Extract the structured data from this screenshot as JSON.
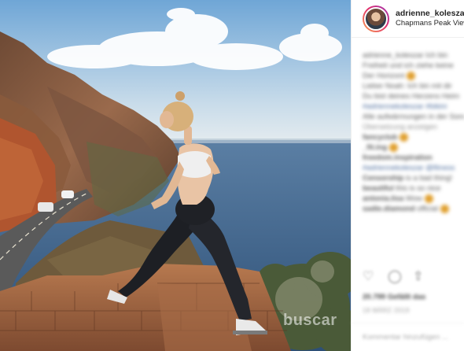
{
  "post": {
    "username": "adrienne_koleszar",
    "location": "Chapmans Peak View"
  },
  "caption": {
    "lines": [
      "adrienne_koleszar Ich bin",
      "Freiheit und ich ziehe keine",
      "Der Horizont ",
      "Lieber Noah: Ich bin mit dir",
      "Du bist deines Herzens Heim",
      "#adriennekoleszar #bikini",
      "Alle aufwärmungen in der Sonne"
    ],
    "translation": "Übersetzung anzeigen"
  },
  "comments": [
    {
      "user": "fancyclub",
      "text": ""
    },
    {
      "user": "_fit.ing",
      "text": ""
    },
    {
      "user": "freedom.inspiration",
      "text": "#adriennekoleszar @fitness"
    },
    {
      "user": "Censorship",
      "text": "is a bad thing!"
    },
    {
      "user": "beautiful",
      "text": "this is so nice"
    },
    {
      "user": "antonia.lisa",
      "text": "Wow "
    },
    {
      "user": "sadie.diamond",
      "text": "official "
    }
  ],
  "likes_text": "20.799 Gefällt das",
  "date_text": "18 MÄRZ 2019",
  "comment_placeholder": "Kommentar hinzufügen ...",
  "watermark": "buscar"
}
